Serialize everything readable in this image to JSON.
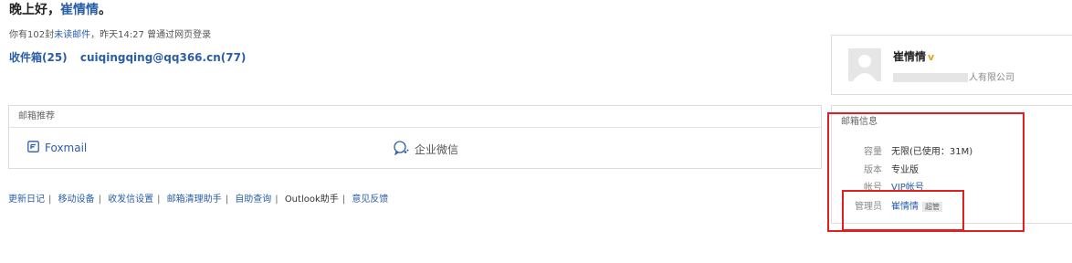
{
  "greeting": {
    "prefix": "晚上好，",
    "name": "崔情情",
    "suffix": "。"
  },
  "login_info": {
    "prefix": "你有102封",
    "unread_link": "未读邮件",
    "suffix": "，昨天14:27 曾通过网页登录"
  },
  "mail_links": {
    "inbox": "收件箱(25)",
    "account": "cuiqingqing@qq366.cn(77)"
  },
  "recommend": {
    "title": "邮箱推荐",
    "items": [
      {
        "label": "Foxmail",
        "icon": "foxmail-icon"
      },
      {
        "label": "企业微信",
        "icon": "wecom-icon"
      }
    ]
  },
  "footer": {
    "links": [
      "更新日记",
      "移动设备",
      "收发信设置",
      "邮箱清理助手",
      "自助查询",
      "Outlook助手",
      "意见反馈"
    ]
  },
  "profile": {
    "name": "崔情情",
    "vip_mark": "v",
    "company_prefix": "",
    "company_suffix": "人有限公司",
    "vip_color": "#e4a21c"
  },
  "mailbox_info": {
    "title": "邮箱信息",
    "rows": [
      {
        "label": "容量",
        "value": "无限(已使用：31M)"
      },
      {
        "label": "版本",
        "value": "专业版"
      },
      {
        "label": "帐号",
        "value": "VIP帐号"
      },
      {
        "label": "管理员",
        "value": "崔情情",
        "badge": "超管"
      }
    ]
  },
  "colors": {
    "link": "#2b5ea8",
    "highlight_box": "#e02020"
  }
}
